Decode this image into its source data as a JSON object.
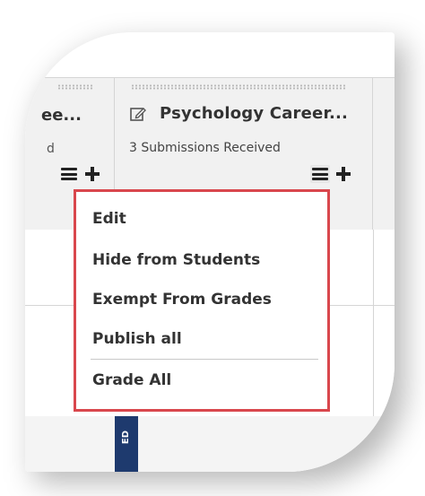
{
  "columns": {
    "left": {
      "title": "ee...",
      "subtitle": "d"
    },
    "main": {
      "title": "Psychology Career...",
      "subtitle": "3 Submissions Received"
    }
  },
  "dropdown": {
    "items": [
      {
        "label": "Edit"
      },
      {
        "label": "Hide from Students"
      },
      {
        "label": "Exempt From Grades"
      },
      {
        "label": "Publish all"
      },
      {
        "label": "Grade All"
      }
    ],
    "border_color": "#d9474d"
  },
  "bottom": {
    "tab_text": "ED"
  },
  "icons": {
    "edit": "edit-icon",
    "menu": "hamburger-menu-icon",
    "add": "plus-icon"
  }
}
